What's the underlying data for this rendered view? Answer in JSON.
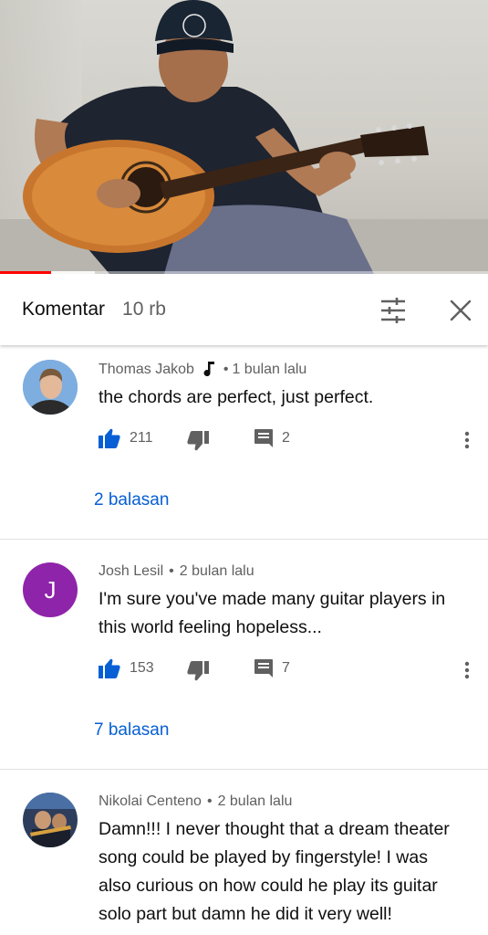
{
  "header": {
    "title": "Komentar",
    "count": "10 rb"
  },
  "video": {
    "progress": 0.105,
    "buffered": 0.195
  },
  "colors": {
    "like_active": "#065fd4",
    "reply_link": "#065fd4",
    "progress": "#ff0000"
  },
  "comments": [
    {
      "author": "Thomas Jakob",
      "author_icon": "music-note-icon",
      "time": "1 bulan lalu",
      "text": "the chords are perfect, just perfect.",
      "likes": "211",
      "reply_count": "2",
      "replies_link": "2 balasan"
    },
    {
      "author": "Josh Lesil",
      "avatar_letter": "J",
      "time": "2 bulan lalu",
      "text_lines": [
        "I'm sure you've made many guitar players in",
        "this world feeling hopeless..."
      ],
      "likes": "153",
      "reply_count": "7",
      "replies_link": "7 balasan"
    },
    {
      "author": "Nikolai Centeno",
      "time": "2 bulan lalu",
      "text_lines": [
        "Damn!!! I never thought that a dream theater",
        "song could be played by fingerstyle! I was",
        "also curious on how could he play its guitar",
        "solo part but damn he did it very well!"
      ]
    }
  ]
}
